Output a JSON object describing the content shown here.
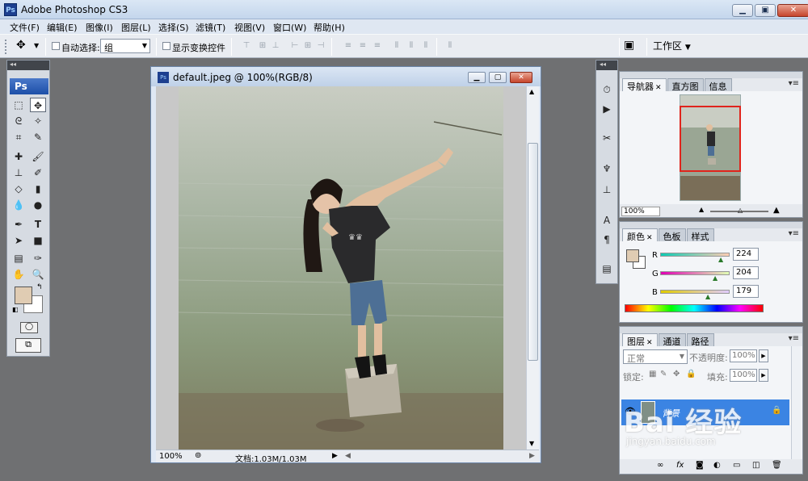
{
  "app": {
    "title": "Adobe Photoshop CS3",
    "icon_label": "Ps"
  },
  "menu": [
    "文件(F)",
    "编辑(E)",
    "图像(I)",
    "图层(L)",
    "选择(S)",
    "滤镜(T)",
    "视图(V)",
    "窗口(W)",
    "帮助(H)"
  ],
  "options_bar": {
    "auto_select_label": "自动选择:",
    "auto_select_value": "组",
    "show_transform_label": "显示变换控件",
    "workspace_label": "工作区"
  },
  "toolbox": {
    "badge": "Ps",
    "foreground_color": "#e0ccb3",
    "background_color": "#ffffff"
  },
  "document": {
    "title": "default.jpeg @ 100%(RGB/8)",
    "zoom": "100%",
    "doc_info": "文档:1.03M/1.03M"
  },
  "navigator_panel": {
    "tabs": [
      "导航器",
      "直方图",
      "信息"
    ],
    "zoom": "100%"
  },
  "color_panel": {
    "tabs": [
      "颜色",
      "色板",
      "样式"
    ],
    "channels": [
      {
        "label": "R",
        "value": "224"
      },
      {
        "label": "G",
        "value": "204"
      },
      {
        "label": "B",
        "value": "179"
      }
    ],
    "swatch_color": "#e0ccb3"
  },
  "layers_panel": {
    "tabs": [
      "图层",
      "通道",
      "路径"
    ],
    "blend_mode": "正常",
    "opacity_label": "不透明度:",
    "opacity_value": "100%",
    "lock_label": "锁定:",
    "fill_label": "填充:",
    "fill_value": "100%",
    "layer_name": "背景"
  },
  "watermark": {
    "brand": "Bai 经验",
    "url": "jingyan.baidu.com"
  }
}
